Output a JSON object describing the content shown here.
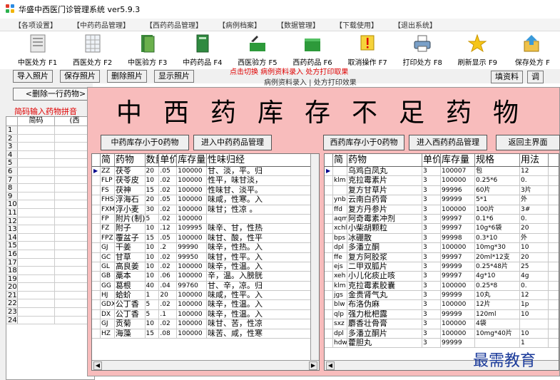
{
  "app": {
    "title": "华盛中西医门诊管理系统 ver5.9.3"
  },
  "menu": [
    "【各项设置】",
    "【中药药品管理】",
    "【西药药品管理】",
    "【病例档案】",
    "【数据管理】",
    "【下载使用】",
    "【退出系统】"
  ],
  "toolbar": [
    {
      "label": "中医处方 F1",
      "icon": "prescription-icon"
    },
    {
      "label": "西医处方 F2",
      "icon": "prescription-grid-icon"
    },
    {
      "label": "中医验方 F3",
      "icon": "book-icon"
    },
    {
      "label": "中药药品 F4",
      "icon": "green-book-icon"
    },
    {
      "label": "西医验方 F5",
      "icon": "box-icon"
    },
    {
      "label": "西药药品 F6",
      "icon": "green-box-icon"
    },
    {
      "label": "取消操作 F7",
      "icon": "warning-icon"
    },
    {
      "label": "打印处方 F8",
      "icon": "printer-icon"
    },
    {
      "label": "刷新显示 F9",
      "icon": "star-icon"
    },
    {
      "label": "保存处方 F",
      "icon": "save-icon"
    }
  ],
  "buttons": [
    "导入照片",
    "保存照片",
    "删除照片",
    "显示照片"
  ],
  "hint": {
    "line1": "点击切换 病例资料录入 处方打印取果",
    "line2": "病例资料录入 | 处方打印效果"
  },
  "right_buttons": [
    "填资料",
    "调"
  ],
  "left": {
    "delete_button": "<删除一行药物>",
    "pinyin_hint": "简码输入药物拼音",
    "col1": "简码",
    "col2": "(西",
    "rows": [
      "1",
      "2",
      "3",
      "4",
      "5",
      "6",
      "7",
      "8",
      "9",
      "10",
      "11",
      "12",
      "13",
      "14",
      "15",
      "16",
      "17",
      "18",
      "19",
      "20",
      "21",
      "22",
      "23",
      "24"
    ]
  },
  "dialog": {
    "title": "中西药库存不足药物",
    "btn_cn_zero": "中药库存小于0药物",
    "btn_cn_manage": "进入中药药品管理",
    "btn_west_zero": "西药库存小于0药物",
    "btn_west_manage": "进入西药药品管理",
    "btn_back": "返回主界面"
  },
  "cn_table": {
    "headers": [
      "简",
      "药物",
      "数量",
      "单价",
      "库存量",
      "性味归经"
    ],
    "rows": [
      [
        "ZZ",
        "茯苓",
        "20",
        ".05",
        "100000",
        "甘、淡，平。归"
      ],
      [
        "FLP",
        "茯苓皮",
        "10",
        ".02",
        "100000",
        "性平，味甘淡，"
      ],
      [
        "FS",
        "茯神",
        "15",
        ".02",
        "100000",
        "性味甘、淡平。"
      ],
      [
        "FHS",
        "浮海石",
        "20",
        ".05",
        "100000",
        "味咸，性寒。入"
      ],
      [
        "FXM",
        "浮小麦",
        "30",
        ".02",
        "100000",
        "味甘；性凉 。"
      ],
      [
        "FP",
        "附片(制)",
        "5",
        ".02",
        "100000",
        ""
      ],
      [
        "FZ",
        "附子",
        "10",
        ".12",
        "109995",
        "味辛、甘，性热"
      ],
      [
        "FPZ",
        "覆盆子",
        "15",
        ".05",
        "100000",
        "味甘、酸，性平"
      ],
      [
        "GJ",
        "干姜",
        "10",
        ".2",
        "99990",
        "味辛，性热。入"
      ],
      [
        "GC",
        "甘草",
        "10",
        ".02",
        "99950",
        "味甘，性平。入"
      ],
      [
        "GL",
        "高良姜",
        "10",
        ".02",
        "100000",
        "味辛，性温。入"
      ],
      [
        "GB",
        "藁本",
        "10",
        ".06",
        "100000",
        "辛，温。入膀胱"
      ],
      [
        "GG",
        "葛根",
        "40",
        ".04",
        "99760",
        "甘、辛，凉。归"
      ],
      [
        "HJ",
        "蛤蚧",
        "1",
        "20",
        "100000",
        "味咸，性平。入"
      ],
      [
        "GDX",
        "公丁香",
        "5",
        ".02",
        "100000",
        "味辛，性温。入"
      ],
      [
        "DX",
        "公丁香",
        "5",
        ".1",
        "100000",
        "味辛，性温。入"
      ],
      [
        "GJ",
        "贡菊",
        "10",
        ".02",
        "100000",
        "味甘、苦，性凉"
      ],
      [
        "HZ",
        "海藻",
        "15",
        ".08",
        "100000",
        "味苦、咸，性寒"
      ]
    ]
  },
  "west_table": {
    "headers": [
      "简",
      "药物",
      "单价",
      "库存量",
      "规格",
      "用法"
    ],
    "rows": [
      [
        "",
        "乌鸡白凤丸",
        "3",
        "100007",
        "包",
        "12"
      ],
      [
        "klm",
        "克拉霉素片",
        "3",
        "100000",
        "0.25*6",
        "0."
      ],
      [
        "",
        "复方甘草片",
        "3",
        "99996",
        "60片",
        "3片"
      ],
      [
        "ynb",
        "云南白药膏",
        "3",
        "99999",
        "5*1",
        "外"
      ],
      [
        "ffd",
        "复方丹参片",
        "3",
        "100000",
        "100片",
        "3#"
      ],
      [
        "aqm",
        "阿奇霉素冲剂",
        "3",
        "99997",
        "0.1*6",
        "0."
      ],
      [
        "xchl",
        "小柴胡颗粒",
        "3",
        "99997",
        "10g*6袋",
        "20"
      ],
      [
        "bps",
        "冰硼散",
        "3",
        "99998",
        "0.3*10",
        "外"
      ],
      [
        "dpl",
        "多潘立酮",
        "3",
        "100000",
        "10mg*30",
        "10"
      ],
      [
        "ffe",
        "复方阿胶浆",
        "3",
        "99997",
        "20ml*12支",
        "20"
      ],
      [
        "ejs",
        "二甲双胍片",
        "3",
        "99999",
        "0.25*48片",
        "25"
      ],
      [
        "xeh",
        "小儿化痰止咳",
        "3",
        "99997",
        "4g*10",
        "4g"
      ],
      [
        "klm",
        "克拉霉素胶囊",
        "3",
        "100000",
        "0.25*8",
        "0."
      ],
      [
        "jgs",
        "金贵肾气丸",
        "3",
        "99999",
        "10丸",
        "12"
      ],
      [
        "blw",
        "布洛伪麻",
        "3",
        "100000",
        "12片",
        "1p"
      ],
      [
        "qlp",
        "强力枇杷露",
        "3",
        "99999",
        "120ml",
        "10"
      ],
      [
        "sxz",
        "麝香壮骨膏",
        "3",
        "100000",
        "4袋",
        ""
      ],
      [
        "dpl",
        "多潘立酮片",
        "3",
        "100000",
        "10mg*40片",
        "10"
      ],
      [
        "hdw",
        "藿胆丸",
        "3",
        "99999",
        "",
        "1"
      ]
    ]
  },
  "watermark": "最需教育"
}
